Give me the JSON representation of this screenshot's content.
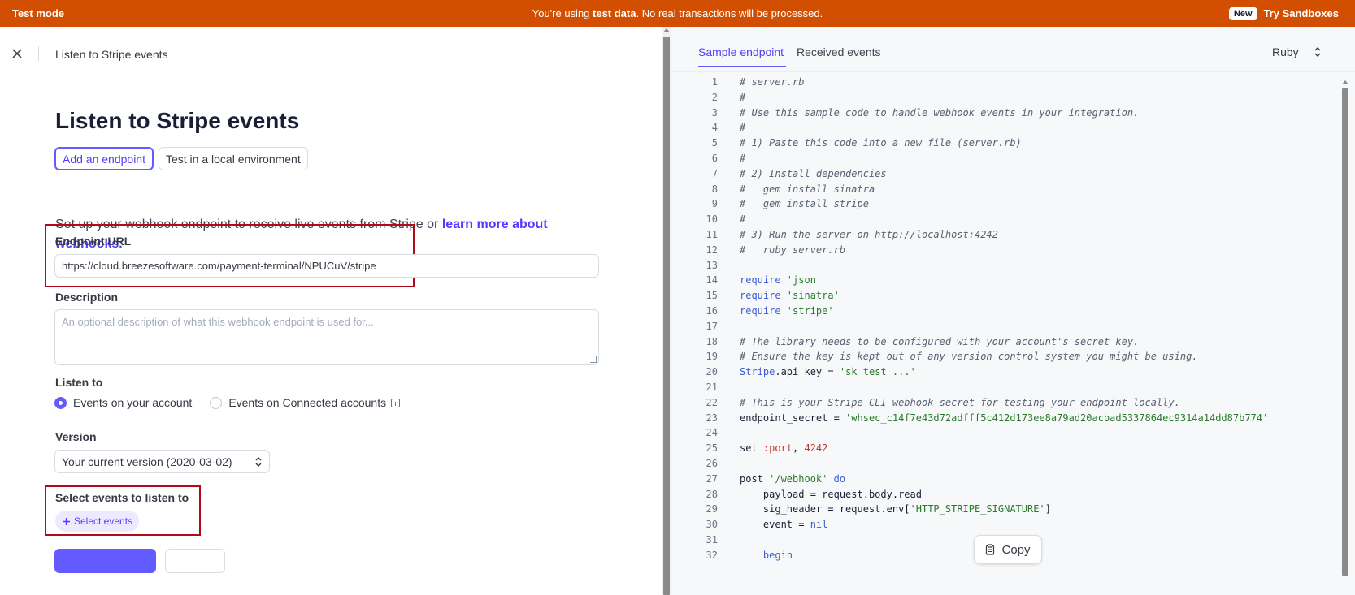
{
  "banner": {
    "mode_label": "Test mode",
    "message_pre": "You're using ",
    "message_bold": "test data",
    "message_post": ". No real transactions will be processed.",
    "new_badge": "New",
    "try_link": "Try Sandboxes",
    "color": "#d24e01"
  },
  "topbar": {
    "title": "Listen to Stripe events"
  },
  "page": {
    "title": "Listen to Stripe events",
    "tabs": [
      {
        "label": "Add an endpoint",
        "active": true
      },
      {
        "label": "Test in a local environment",
        "active": false
      }
    ],
    "intro_text": "Set up your webhook endpoint to receive live events from Stripe or ",
    "intro_link": "learn more about webhooks."
  },
  "form": {
    "endpoint_label": "Endpoint URL",
    "endpoint_value": "https://cloud.breezesoftware.com/payment-terminal/NPUCuV/stripe",
    "description_label": "Description",
    "description_placeholder": "An optional description of what this webhook endpoint is used for...",
    "listen_to_label": "Listen to",
    "listen_options": [
      {
        "label": "Events on your account",
        "checked": true
      },
      {
        "label": "Events on Connected accounts",
        "checked": false
      }
    ],
    "version_label": "Version",
    "version_value": "Your current version (2020-03-02)",
    "select_events_label": "Select events to listen to",
    "select_events_button": "Select events"
  },
  "code_panel": {
    "tabs": [
      {
        "label": "Sample endpoint",
        "active": true
      },
      {
        "label": "Received events",
        "active": false
      }
    ],
    "language": "Ruby",
    "copy_label": "Copy",
    "lines": [
      {
        "n": "1",
        "t": "# server.rb"
      },
      {
        "n": "2",
        "t": "#"
      },
      {
        "n": "3",
        "t": "# Use this sample code to handle webhook events in your integration."
      },
      {
        "n": "4",
        "t": "#"
      },
      {
        "n": "5",
        "t": "# 1) Paste this code into a new file (server.rb)"
      },
      {
        "n": "6",
        "t": "#"
      },
      {
        "n": "7",
        "t": "# 2) Install dependencies"
      },
      {
        "n": "8",
        "t": "#   gem install sinatra"
      },
      {
        "n": "9",
        "t": "#   gem install stripe"
      },
      {
        "n": "10",
        "t": "#"
      },
      {
        "n": "11",
        "t": "# 3) Run the server on http://localhost:4242"
      },
      {
        "n": "12",
        "t": "#   ruby server.rb"
      },
      {
        "n": "13",
        "t": ""
      },
      {
        "n": "14",
        "kw": "require",
        "str": " 'json'"
      },
      {
        "n": "15",
        "kw": "require",
        "str": " 'sinatra'"
      },
      {
        "n": "16",
        "kw": "require",
        "str": " 'stripe'"
      },
      {
        "n": "17",
        "t": ""
      },
      {
        "n": "18",
        "t": "# The library needs to be configured with your account's secret key."
      },
      {
        "n": "19",
        "t": "# Ensure the key is kept out of any version control system you might be using."
      },
      {
        "n": "20",
        "kw": "Stripe",
        "plain": ".api_key = ",
        "str": "'sk_test_...'"
      },
      {
        "n": "21",
        "t": ""
      },
      {
        "n": "22",
        "t": "# This is your Stripe CLI webhook secret for testing your endpoint locally."
      },
      {
        "n": "23",
        "plain": "endpoint_secret = ",
        "str": "'whsec_c14f7e43d72adfff5c412d173ee8a79ad20acbad5337864ec9314a14dd87b774'"
      },
      {
        "n": "24",
        "t": ""
      },
      {
        "n": "25",
        "plain": "set ",
        "sym": ":port",
        "plain2": ", ",
        "num": "4242"
      },
      {
        "n": "26",
        "t": ""
      },
      {
        "n": "27",
        "plain": "post ",
        "str": "'/webhook'",
        "kw2": " do"
      },
      {
        "n": "28",
        "plain": "    payload = request.body.read"
      },
      {
        "n": "29",
        "plain": "    sig_header = request.env[",
        "str": "'HTTP_STRIPE_SIGNATURE'",
        "plain2": "]"
      },
      {
        "n": "30",
        "plain": "    event = ",
        "kw2": "nil"
      },
      {
        "n": "31",
        "t": ""
      },
      {
        "n": "32",
        "kw": "    begin"
      }
    ]
  }
}
